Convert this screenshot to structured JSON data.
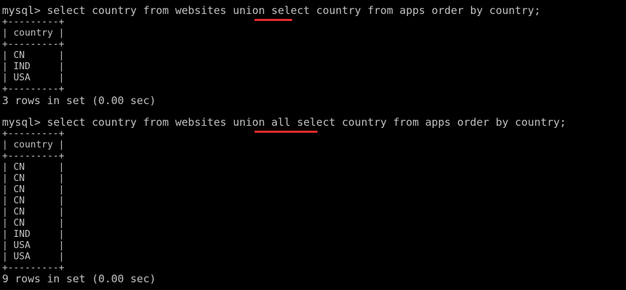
{
  "colors": {
    "background": "#000000",
    "text": "#c0c0c0",
    "highlight_underline": "#e52b2b"
  },
  "query1": {
    "prompt": "mysql> ",
    "before": "select country from websites ",
    "keyword": "union",
    "after": " select country from apps order by country;",
    "border": "+---------+",
    "header_row": "| country |",
    "rows": [
      "| CN      |",
      "| IND     |",
      "| USA     |"
    ],
    "status": "3 rows in set (0.00 sec)"
  },
  "query2": {
    "prompt": "mysql> ",
    "before": "select country from websites ",
    "keyword": "union all",
    "after": " select country from apps order by country;",
    "border": "+---------+",
    "header_row": "| country |",
    "rows": [
      "| CN      |",
      "| CN      |",
      "| CN      |",
      "| CN      |",
      "| CN      |",
      "| CN      |",
      "| IND     |",
      "| USA     |",
      "| USA     |"
    ],
    "status": "9 rows in set (0.00 sec)"
  }
}
